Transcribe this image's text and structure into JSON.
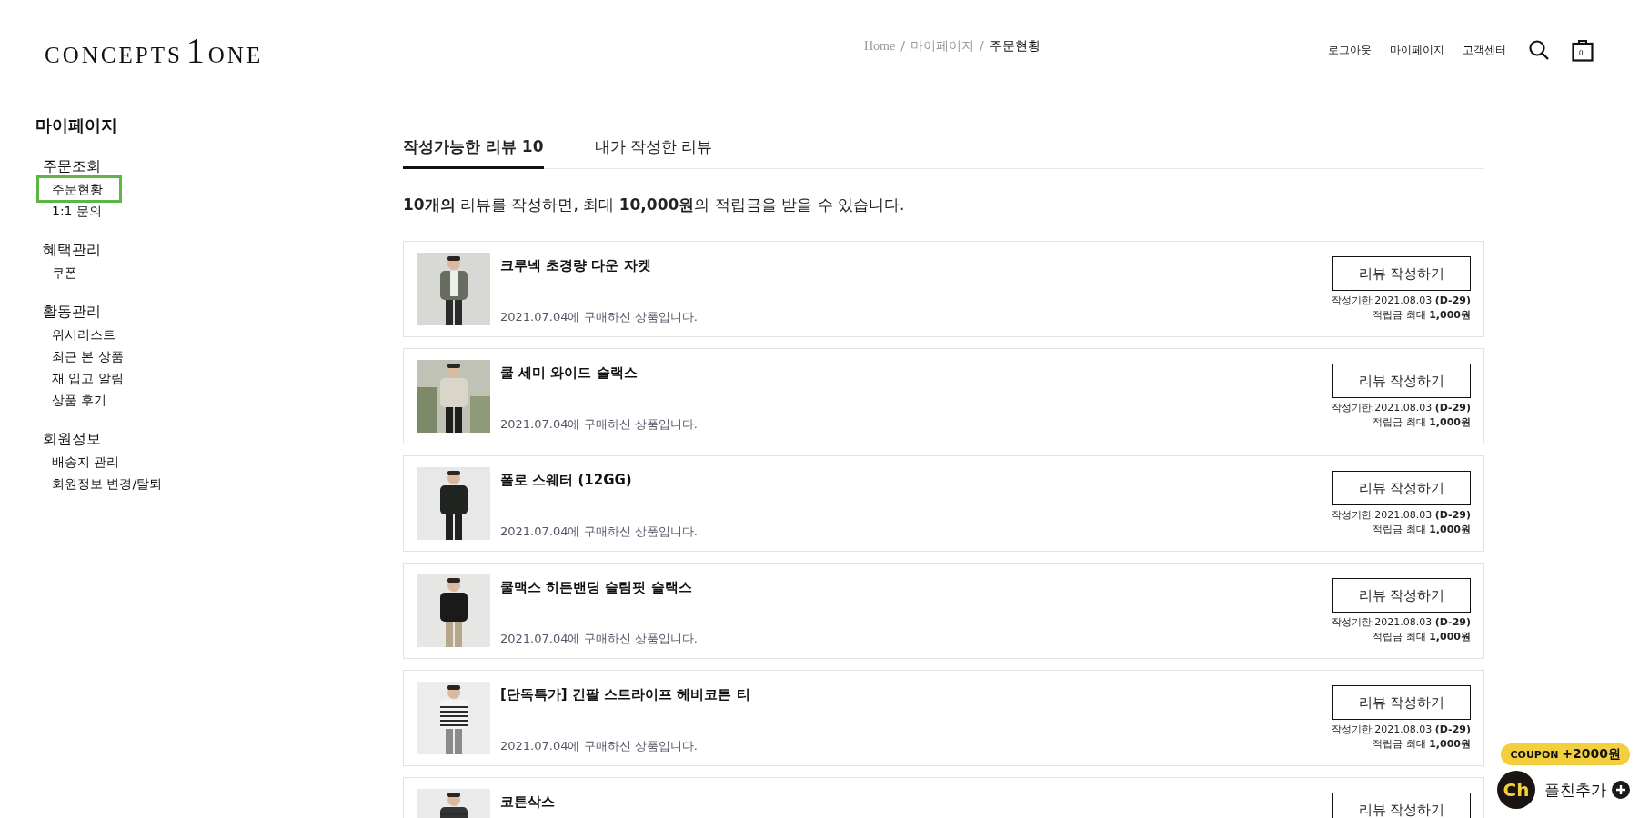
{
  "header": {
    "logo": {
      "left": "CONCEPTS",
      "mark": "1",
      "right": "ONE"
    },
    "breadcrumb": {
      "separator": "/",
      "items": [
        {
          "label": "Home",
          "current": false
        },
        {
          "label": "마이페이지",
          "current": false
        },
        {
          "label": "주문현황",
          "current": true
        }
      ]
    },
    "nav": [
      "로그아웃",
      "마이페이지",
      "고객센터"
    ],
    "cart_count": "0"
  },
  "sidebar": {
    "title": "마이페이지",
    "groups": [
      {
        "label": "주문조회",
        "items": [
          {
            "label": "주문현황",
            "selected": true
          },
          {
            "label": "1:1 문의",
            "selected": false
          }
        ]
      },
      {
        "label": "혜택관리",
        "items": [
          {
            "label": "쿠폰",
            "selected": false
          }
        ]
      },
      {
        "label": "활동관리",
        "items": [
          {
            "label": "위시리스트",
            "selected": false
          },
          {
            "label": "최근 본 상품",
            "selected": false
          },
          {
            "label": "재 입고 알림",
            "selected": false
          },
          {
            "label": "상품 후기",
            "selected": false
          }
        ]
      },
      {
        "label": "회원정보",
        "items": [
          {
            "label": "배송지 관리",
            "selected": false
          },
          {
            "label": "회원정보 변경/탈퇴",
            "selected": false
          }
        ]
      }
    ]
  },
  "tabs": [
    {
      "label": "작성가능한 리뷰 10",
      "selected": true
    },
    {
      "label": "내가 작성한 리뷰",
      "selected": false
    }
  ],
  "notice": "**10개의** 리뷰를 작성하면, 최대 **10,000원**의 적립금을 받을 수 있습니다.",
  "products": [
    {
      "name": "크루넥 초경량 다운 자켓",
      "purchase": "2021.07.04에 구매하신 상품입니다.",
      "button": "리뷰 작성하기",
      "deadline": "작성기한:2021.08.03 **(D-29)**",
      "reward": "적립금 최대 **1,000원**"
    },
    {
      "name": "쿨 세미 와이드 슬랙스",
      "purchase": "2021.07.04에 구매하신 상품입니다.",
      "button": "리뷰 작성하기",
      "deadline": "작성기한:2021.08.03 **(D-29)**",
      "reward": "적립금 최대 **1,000원**"
    },
    {
      "name": "폴로 스웨터 (12GG)",
      "purchase": "2021.07.04에 구매하신 상품입니다.",
      "button": "리뷰 작성하기",
      "deadline": "작성기한:2021.08.03 **(D-29)**",
      "reward": "적립금 최대 **1,000원**"
    },
    {
      "name": "쿨맥스 히든밴딩 슬림핏 슬랙스",
      "purchase": "2021.07.04에 구매하신 상품입니다.",
      "button": "리뷰 작성하기",
      "deadline": "작성기한:2021.08.03 **(D-29)**",
      "reward": "적립금 최대 **1,000원**"
    },
    {
      "name": "[단독특가] 긴팔 스트라이프 헤비코튼 티",
      "purchase": "2021.07.04에 구매하신 상품입니다.",
      "button": "리뷰 작성하기",
      "deadline": "작성기한:2021.08.03 **(D-29)**",
      "reward": "적립금 최대 **1,000원**"
    },
    {
      "name": "코튼삭스",
      "button": "리뷰 작성하기"
    }
  ],
  "chat_widget": {
    "coupon": "COUPON **+2000원**",
    "logo": "Ch",
    "label": "플친추가"
  }
}
